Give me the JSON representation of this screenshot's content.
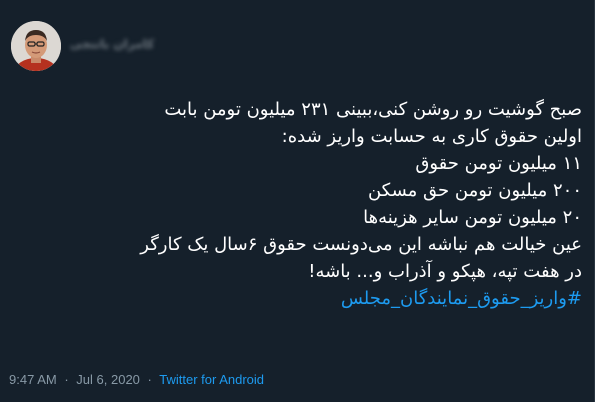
{
  "tweet": {
    "author": {
      "display_name": "کامران باتنجی"
    },
    "lines": [
      "صبح گوشیت رو روشن کنی،ببینی ۲۳۱ میلیون تومن بابت",
      "اولین حقوق کاری به حسابت واریز شده:",
      "۱۱ میلیون تومن حقوق",
      "۲۰۰ میلیون تومن حق مسکن",
      "۲۰ میلیون تومن سایر هزینه‌ها",
      "عین خیالت هم نباشه این می‌دونست حقوق ۶سال یک کارگر",
      "در هفت تپه، هپکو و آذراب و...  باشه!"
    ],
    "hashtag": "#واریز_حقوق_نمایندگان_مجلس",
    "time": "9:47 AM",
    "separator_1": "·",
    "date": "Jul 6, 2020",
    "separator_2": "·",
    "source": "Twitter for Android"
  },
  "colors": {
    "background": "#15202b",
    "text": "#ffffff",
    "link": "#1d9bf0",
    "meta": "#8899a6"
  }
}
